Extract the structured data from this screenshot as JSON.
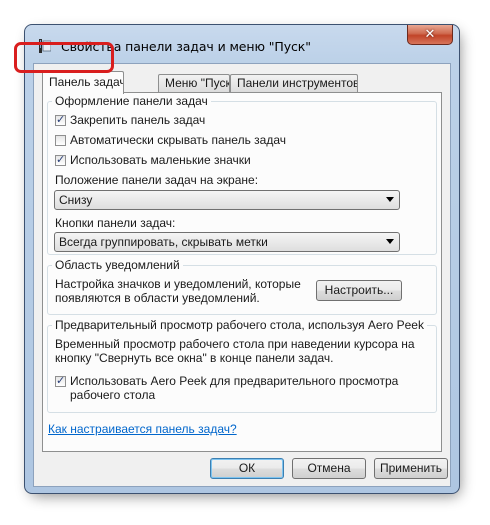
{
  "window": {
    "title": "Свойства панели задач и меню \"Пуск\"",
    "close_symbol": "✕",
    "icon": "taskbar-properties-icon"
  },
  "tabs": [
    {
      "label": "Панель задач",
      "active": true
    },
    {
      "label": "Меню \"Пуск\"",
      "active": false
    },
    {
      "label": "Панели инструментов",
      "active": false
    }
  ],
  "appearance": {
    "label": "Оформление панели задач",
    "lock_taskbar": {
      "label": "Закрепить панель задач",
      "checked": true
    },
    "auto_hide": {
      "label": "Автоматически скрывать панель задач",
      "checked": false
    },
    "small_icons": {
      "label": "Использовать маленькие значки",
      "checked": true
    },
    "location_label": "Положение панели задач на экране:",
    "location_value": "Снизу",
    "buttons_label": "Кнопки панели задач:",
    "buttons_value": "Всегда группировать, скрывать метки"
  },
  "notification": {
    "label": "Область уведомлений",
    "text_line1": "Настройка значков и уведомлений, которые",
    "text_line2": "появляются в области уведомлений.",
    "customize_button": "Настроить..."
  },
  "peek": {
    "label": "Предварительный просмотр рабочего стола, используя Aero Peek",
    "text_line1": "Временный просмотр рабочего стола при наведении курсора на",
    "text_line2": "кнопку \"Свернуть все окна\" в конце панели задач.",
    "checkbox_line1": "Использовать Aero Peek для предварительного просмотра",
    "checkbox_line2": "рабочего стола",
    "checked": true
  },
  "help_link": "Как настраивается панель задач?",
  "footer": {
    "ok": "ОК",
    "cancel": "Отмена",
    "apply": "Применить"
  },
  "colors": {
    "highlight": "#d91e1e",
    "link": "#0066cc",
    "close_button": "#c14428"
  }
}
